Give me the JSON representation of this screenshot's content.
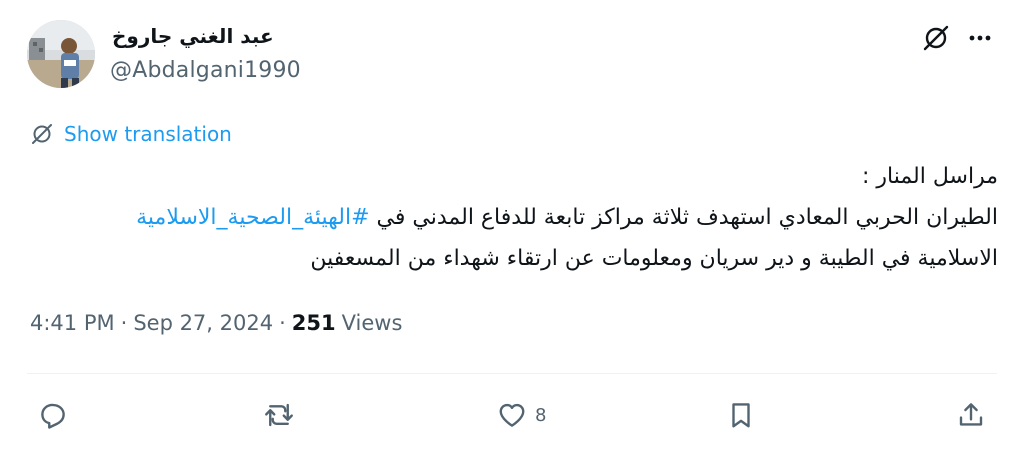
{
  "author": {
    "display_name": "عبد الغني جاروخ",
    "handle": "@Abdalgani1990"
  },
  "translate": {
    "label": "Show translation"
  },
  "tweet": {
    "line1": "مراسل المنار :",
    "line2_text": "الطيران الحربي المعادي استهدف ثلاثة مراكز تابعة للدفاع المدني في ",
    "hashtag": "#الهيئة_الصحية_الاسلامية",
    "line3": "الاسلامية في الطيبة و دير سريان ومعلومات عن ارتقاء شهداء من المسعفين"
  },
  "meta": {
    "time": "4:41 PM",
    "sep1": "·",
    "date": "Sep 27, 2024",
    "sep2": "·",
    "views_count": "251",
    "views_label": "Views"
  },
  "actions": {
    "like_count": "8"
  },
  "colors": {
    "accent": "#1d9bf0",
    "secondary_text": "#536471",
    "primary_text": "#0f1419"
  },
  "icons": {
    "reply": "reply-icon",
    "retweet": "retweet-icon",
    "like": "heart-icon",
    "bookmark": "bookmark-icon",
    "share": "share-icon",
    "grok": "grok-icon",
    "more": "more-icon",
    "translate": "translate-icon"
  }
}
